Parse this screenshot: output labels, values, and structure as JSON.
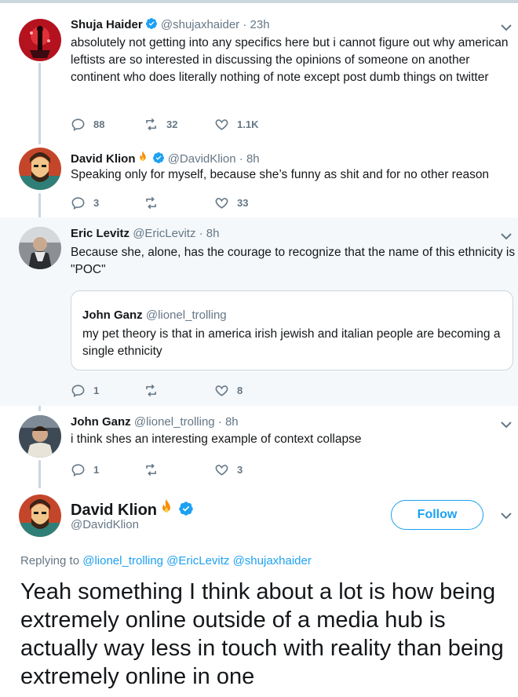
{
  "colors": {
    "accent": "#1da1f2",
    "secondary_text": "#657786",
    "thread_line": "#ccd6dd",
    "highlight_bg": "#f5f8fa"
  },
  "tweets": [
    {
      "name": "Shuja Haider",
      "handle": "@shujaxhaider",
      "time": "23h",
      "verified": true,
      "text": "absolutely not getting into any specifics here but i cannot figure out why american leftists are so interested in discussing the opinions of someone on another continent who does literally nothing of note except post dumb things on twitter",
      "replies": "88",
      "retweets": "32",
      "likes": "1.1K"
    },
    {
      "name": "David Klion",
      "handle": "@DavidKlion",
      "time": "8h",
      "verified": true,
      "emoji": "fire",
      "text": "Speaking only for myself, because she’s funny as shit and for no other reason",
      "replies": "3",
      "retweets": "",
      "likes": "33"
    },
    {
      "name": "Eric Levitz",
      "handle": "@EricLevitz",
      "time": "8h",
      "verified": false,
      "text": "Because she, alone, has the courage to recognize that the name of this ethnicity is \"POC\"",
      "replies": "1",
      "retweets": "",
      "likes": "8",
      "quote": {
        "name": "John Ganz",
        "handle": "@lionel_trolling",
        "text": "my pet theory is that in america irish jewish and italian people are becoming a single ethnicity"
      }
    },
    {
      "name": "John Ganz",
      "handle": "@lionel_trolling",
      "time": "8h",
      "verified": false,
      "text": "i think shes an interesting example of context collapse",
      "replies": "1",
      "retweets": "",
      "likes": "3"
    }
  ],
  "main_tweet": {
    "name": "David Klion",
    "handle": "@DavidKlion",
    "follow_label": "Follow",
    "replying_prefix": "Replying to",
    "replying_to": "@lionel_trolling @EricLevitz @shujaxhaider",
    "text": "Yeah something I think about a lot is how being extremely online outside of a media hub is actually way less in touch with reality than being extremely online in one"
  }
}
